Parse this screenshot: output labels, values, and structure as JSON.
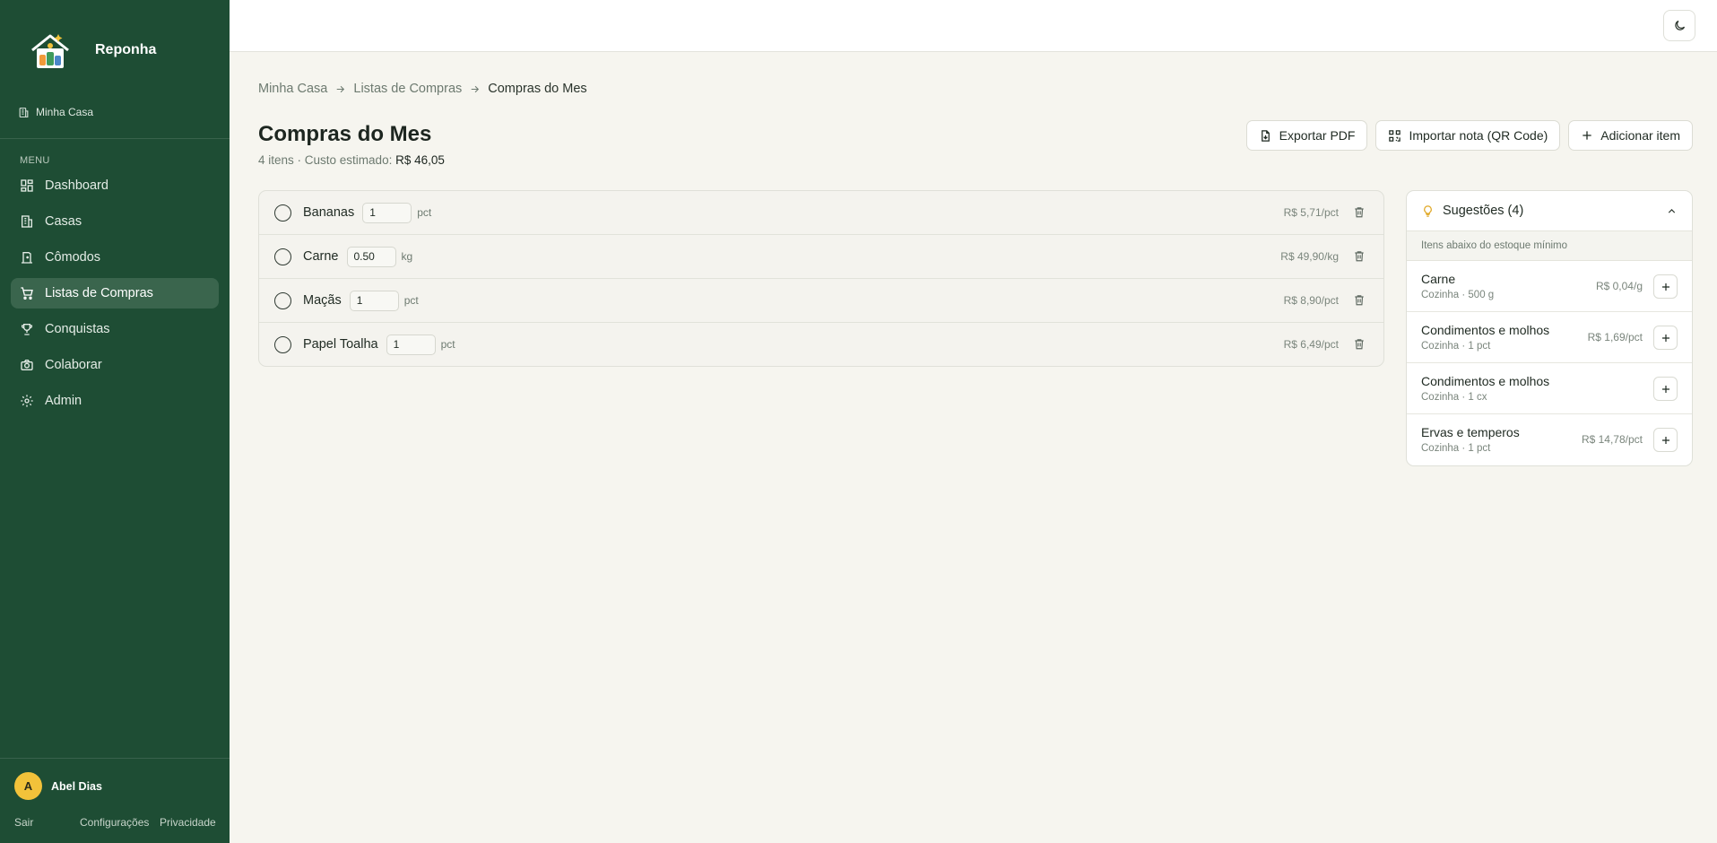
{
  "app": {
    "name": "Reponha"
  },
  "sidebar": {
    "house": "Minha Casa",
    "menu_label": "MENU",
    "items": [
      {
        "label": "Dashboard",
        "icon": "dashboard-icon",
        "active": false
      },
      {
        "label": "Casas",
        "icon": "buildings-icon",
        "active": false
      },
      {
        "label": "Cômodos",
        "icon": "door-icon",
        "active": false
      },
      {
        "label": "Listas de Compras",
        "icon": "cart-icon",
        "active": true
      },
      {
        "label": "Conquistas",
        "icon": "trophy-icon",
        "active": false
      },
      {
        "label": "Colaborar",
        "icon": "camera-icon",
        "active": false
      },
      {
        "label": "Admin",
        "icon": "gear-icon",
        "active": false
      }
    ],
    "user": {
      "initial": "A",
      "name": "Abel Dias"
    },
    "footer": {
      "logout": "Sair",
      "settings": "Configurações",
      "privacy": "Privacidade"
    }
  },
  "breadcrumb": {
    "home": "Minha Casa",
    "lists": "Listas de Compras",
    "current": "Compras do Mes"
  },
  "page": {
    "title": "Compras do Mes",
    "items_count": "4 itens",
    "sep": " · ",
    "cost_label": "Custo estimado:",
    "cost_value": "R$ 46,05"
  },
  "actions": {
    "export": "Exportar PDF",
    "import": "Importar nota (QR Code)",
    "add": "Adicionar item"
  },
  "items": [
    {
      "name": "Bananas",
      "qty": "1",
      "unit": "pct",
      "price": "R$ 5,71/pct"
    },
    {
      "name": "Carne",
      "qty": "0.50",
      "unit": "kg",
      "price": "R$ 49,90/kg"
    },
    {
      "name": "Maçãs",
      "qty": "1",
      "unit": "pct",
      "price": "R$ 8,90/pct"
    },
    {
      "name": "Papel Toalha",
      "qty": "1",
      "unit": "pct",
      "price": "R$ 6,49/pct"
    }
  ],
  "suggestions": {
    "title": "Sugestões (4)",
    "note": "Itens abaixo do estoque mínimo",
    "items": [
      {
        "name": "Carne",
        "meta": "Cozinha · 500 g",
        "price": "R$ 0,04/g"
      },
      {
        "name": "Condimentos e molhos",
        "meta": "Cozinha · 1 pct",
        "price": "R$ 1,69/pct"
      },
      {
        "name": "Condimentos e molhos",
        "meta": "Cozinha · 1 cx",
        "price": ""
      },
      {
        "name": "Ervas e temperos",
        "meta": "Cozinha · 1 pct",
        "price": "R$ 14,78/pct"
      }
    ]
  },
  "colors": {
    "sidebar": "#1e4d34",
    "sidebar_active": "#3a654d",
    "background": "#f6f5ef",
    "avatar": "#f2c23a",
    "bulb": "#e0a826"
  }
}
